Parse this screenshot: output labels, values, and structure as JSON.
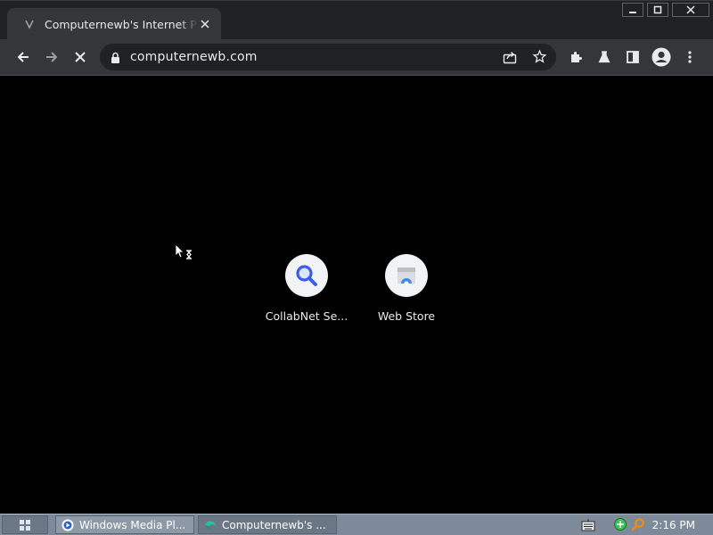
{
  "window": {
    "controls": {
      "minimize": "—",
      "restore": "☐",
      "close": "✕"
    }
  },
  "tab": {
    "title": "Computernewb's Internet Pub",
    "favicon": "loading-icon"
  },
  "toolbar": {
    "url": "computernewb.com",
    "icons": [
      "back-icon",
      "forward-icon",
      "stop-icon",
      "lock-icon",
      "share-icon",
      "star-icon",
      "extensions-icon",
      "labs-icon",
      "side-panel-icon",
      "profile-icon",
      "menu-icon"
    ]
  },
  "shortcuts": [
    {
      "label": "CollabNet Se...",
      "icon": "search-icon"
    },
    {
      "label": "Web Store",
      "icon": "webstore-icon"
    }
  ],
  "taskbar": {
    "items": [
      {
        "label": "Windows Media Pl...",
        "icon": "media-player-icon"
      },
      {
        "label": "Computernewb's ...",
        "icon": "browser-icon"
      }
    ],
    "clock": "2:16 PM"
  },
  "colors": {
    "chrome_dark": "#202124",
    "toolbar": "#35363a",
    "taskbar": "#7d8a99",
    "accent_blue": "#3b5ee7"
  }
}
